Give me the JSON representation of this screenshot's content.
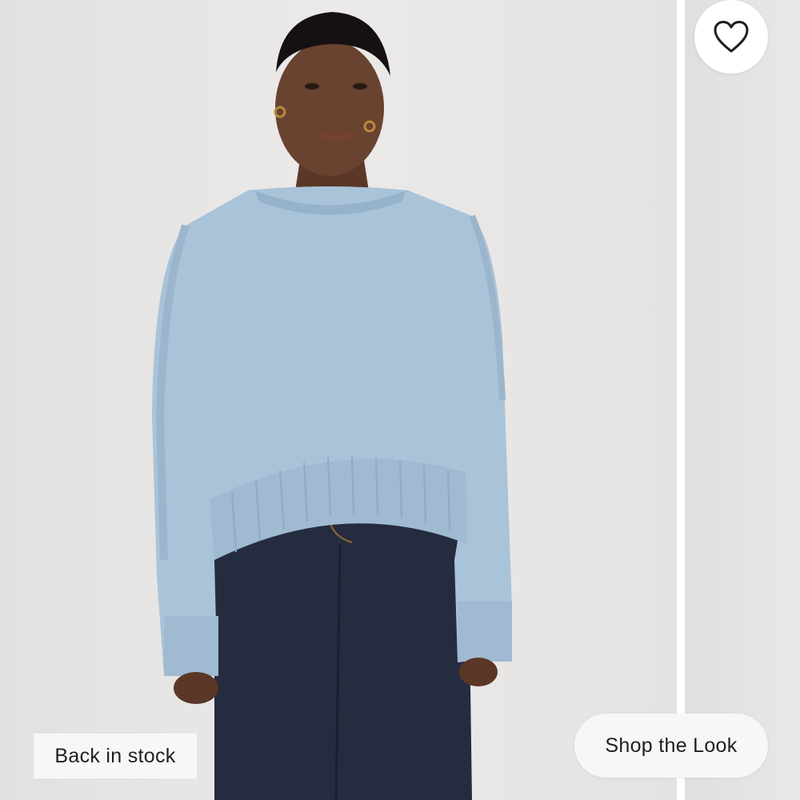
{
  "product": {
    "image_alt": "Model wearing light blue crew-neck sweater and dark denim jeans",
    "sweater_color": "#a9c3d9",
    "denim_color": "#262c40"
  },
  "actions": {
    "favorite_icon": "heart-outline-icon",
    "shop_the_look_label": "Shop the Look"
  },
  "badge": {
    "label": "Back in stock"
  }
}
